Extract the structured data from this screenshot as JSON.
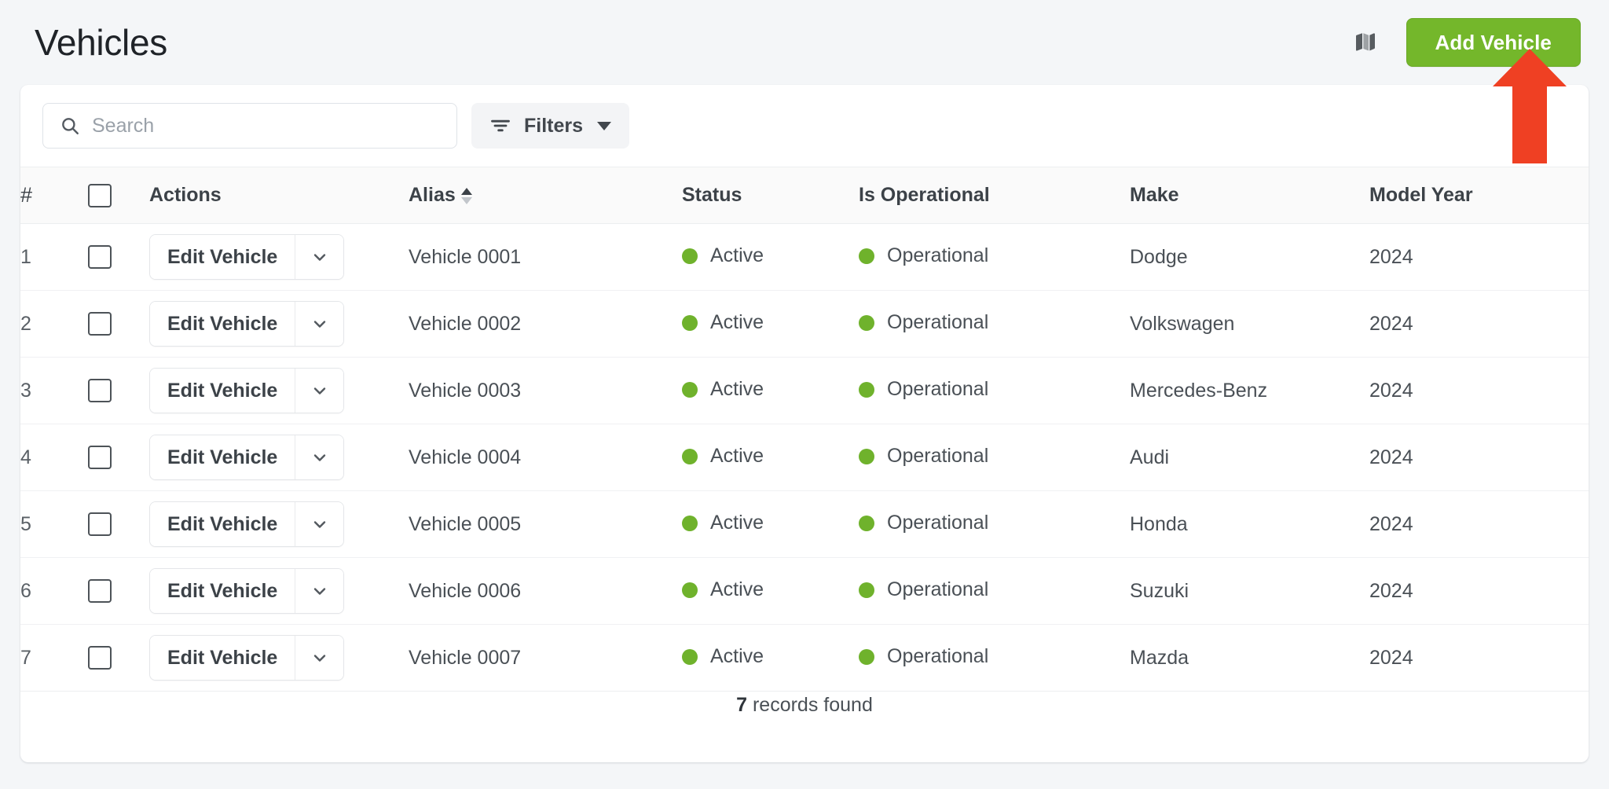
{
  "header": {
    "title": "Vehicles",
    "map_icon": "map-icon",
    "add_button_label": "Add Vehicle",
    "add_button_color": "#74b72b"
  },
  "toolbar": {
    "search_placeholder": "Search",
    "search_value": "",
    "search_icon": "search-icon",
    "filters_label": "Filters",
    "filters_icon": "filter-lines-icon",
    "filters_caret": "chevron-down-icon"
  },
  "table": {
    "columns": [
      {
        "key": "num",
        "label": "#"
      },
      {
        "key": "check",
        "label": ""
      },
      {
        "key": "actions",
        "label": "Actions"
      },
      {
        "key": "alias",
        "label": "Alias",
        "sortable": true,
        "sort_direction": "asc"
      },
      {
        "key": "status",
        "label": "Status"
      },
      {
        "key": "oper",
        "label": "Is Operational"
      },
      {
        "key": "make",
        "label": "Make"
      },
      {
        "key": "year",
        "label": "Model Year"
      }
    ],
    "action_button_label": "Edit Vehicle",
    "action_caret_icon": "chevron-down-icon",
    "status_dot_color": "#6fb22c",
    "rows": [
      {
        "num": "1",
        "alias": "Vehicle 0001",
        "status": "Active",
        "operational": "Operational",
        "make": "Dodge",
        "year": "2024",
        "checked": false
      },
      {
        "num": "2",
        "alias": "Vehicle 0002",
        "status": "Active",
        "operational": "Operational",
        "make": "Volkswagen",
        "year": "2024",
        "checked": false
      },
      {
        "num": "3",
        "alias": "Vehicle 0003",
        "status": "Active",
        "operational": "Operational",
        "make": "Mercedes-Benz",
        "year": "2024",
        "checked": false
      },
      {
        "num": "4",
        "alias": "Vehicle 0004",
        "status": "Active",
        "operational": "Operational",
        "make": "Audi",
        "year": "2024",
        "checked": false
      },
      {
        "num": "5",
        "alias": "Vehicle 0005",
        "status": "Active",
        "operational": "Operational",
        "make": "Honda",
        "year": "2024",
        "checked": false
      },
      {
        "num": "6",
        "alias": "Vehicle 0006",
        "status": "Active",
        "operational": "Operational",
        "make": "Suzuki",
        "year": "2024",
        "checked": false
      },
      {
        "num": "7",
        "alias": "Vehicle 0007",
        "status": "Active",
        "operational": "Operational",
        "make": "Mazda",
        "year": "2024",
        "checked": false
      }
    ]
  },
  "footer": {
    "records_count": "7",
    "records_suffix": " records found"
  },
  "annotation": {
    "arrow": "up-arrow-annotation",
    "color": "#ef4023",
    "points_at": "Add Vehicle"
  }
}
